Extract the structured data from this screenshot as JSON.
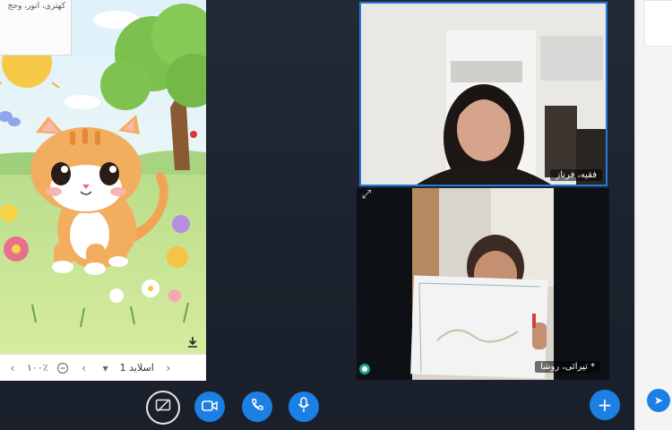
{
  "slide": {
    "note_text": "کهتری، انور، وحج",
    "toolbar": {
      "zoom_text": "۱۰۰٪",
      "slide_label": "اسلاید 1"
    },
    "icons": {
      "prev": "chevron-left-icon",
      "next": "chevron-right-icon",
      "dropdown": "chevron-down-icon",
      "zoom_out": "zoom-out-icon",
      "download": "download-icon"
    }
  },
  "participants": [
    {
      "name": "فقیه، فرناز",
      "speaking": true
    },
    {
      "name": "* تیرائی، روشا",
      "speaking": false
    }
  ],
  "controls": {
    "share": "screen-share-icon",
    "video": "video-camera-icon",
    "call": "phone-icon",
    "mic": "microphone-icon",
    "add": "plus-icon",
    "send": "send-icon"
  },
  "colors": {
    "accent": "#1c7fe3",
    "active_border": "#1f7be0",
    "panel_bg": "#1f2430",
    "mic_badge": "#1aa68a"
  }
}
